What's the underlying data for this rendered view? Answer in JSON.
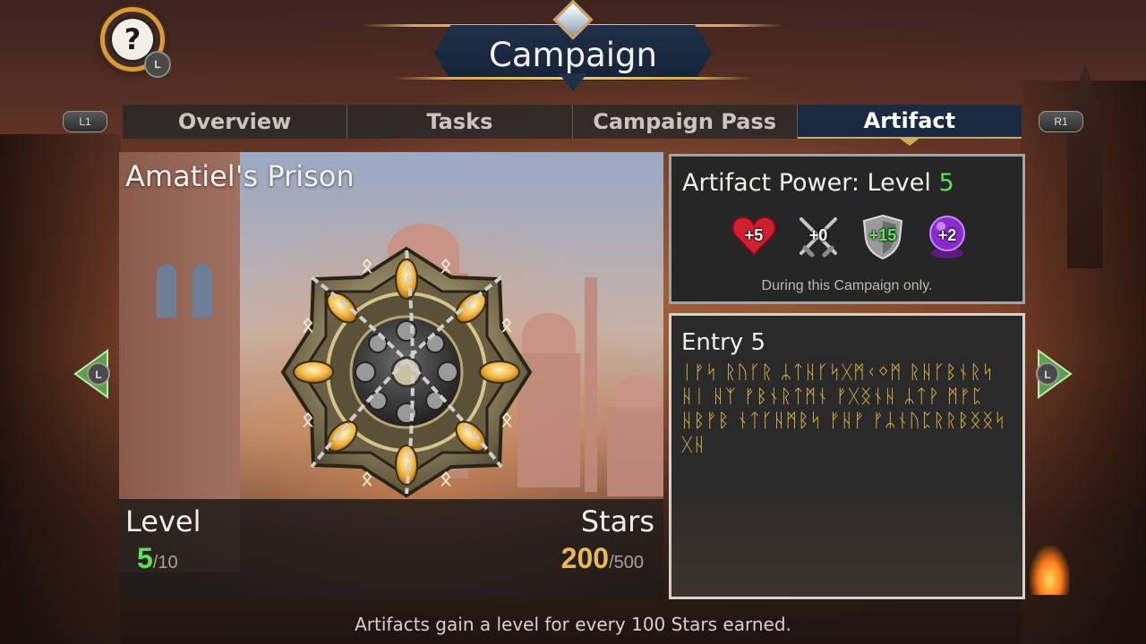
{
  "header": {
    "title": "Campaign",
    "help_glyph": "?",
    "help_button_hint": "L"
  },
  "tabs": {
    "left_shoulder": "L1",
    "right_shoulder": "R1",
    "items": [
      {
        "label": "Overview",
        "active": false
      },
      {
        "label": "Tasks",
        "active": false
      },
      {
        "label": "Campaign Pass",
        "active": false
      },
      {
        "label": "Artifact",
        "active": true
      }
    ]
  },
  "artifact": {
    "name": "Amatiel's Prison",
    "icon": "artifact-emblem-icon",
    "level_label": "Level",
    "level_current": "5",
    "level_max": "/10",
    "stars_label": "Stars",
    "stars_current": "200",
    "stars_max": "/500"
  },
  "power": {
    "title_prefix": "Artifact Power: Level",
    "level": "5",
    "stats": [
      {
        "icon": "heart-icon",
        "value": "+5",
        "color": "#d02030"
      },
      {
        "icon": "crossed-swords-icon",
        "value": "+0",
        "color": "#c0c0c0"
      },
      {
        "icon": "shield-icon",
        "value": "+15",
        "color": "#9a9a9a"
      },
      {
        "icon": "crystal-ball-icon",
        "value": "+2",
        "color": "#8a2ccc"
      }
    ],
    "note": "During this Campaign only."
  },
  "entry": {
    "title": "Entry 5",
    "runes": "ᛁᚠᛋ ᚱᚢᚴᚱ ᛦᛏᚺᚴᛋᚷᛗᚲᛜᛗ ᚱᚺᚴᛒᚾᚱᛋ ᚺᛁ ᚺᛉ ᚠᛒᚾᚱᛏᛗᚾ ᚠᚷᛝᚾᚺ ᛦᛏᚹ ᛗᚠᛈ ᚺᛒᚠᛒ ᚾᛏᚴᚺᛗᛒᛋ ᚠᚺᚠ ᚠᛦᚾᚢᛈᚱᚱᛒᛝᛝᛋ ᚷᚺ"
  },
  "nav": {
    "prev_hint": "L",
    "next_hint": "L"
  },
  "footer": {
    "tip": "Artifacts gain a level for every 100 Stars earned."
  },
  "colors": {
    "accent_gold": "#d4a85a",
    "level_green": "#5ee05a",
    "stars_gold": "#e8b85a",
    "tab_active": "#1d2b42"
  }
}
